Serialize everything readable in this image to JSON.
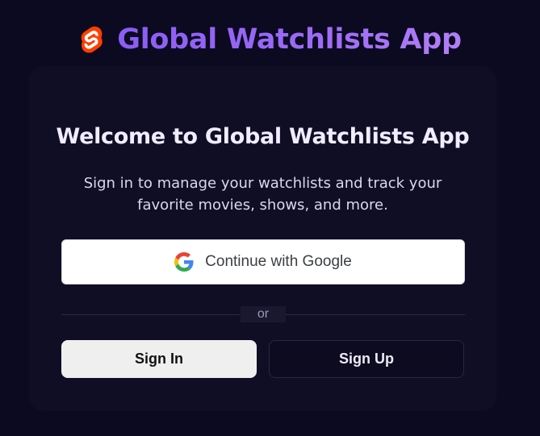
{
  "header": {
    "logo_icon": "svelte-logo-icon",
    "title": "Global Watchlists App"
  },
  "card": {
    "heading": "Welcome to Global Watchlists App",
    "subtitle": "Sign in to manage your watchlists and track your favorite movies, shows, and more.",
    "google_button_label": "Continue with Google",
    "google_icon": "google-icon",
    "divider_label": "or",
    "sign_in_label": "Sign In",
    "sign_up_label": "Sign Up"
  },
  "colors": {
    "background": "#0b0a20",
    "card_background": "#100e25",
    "title_gradient_start": "#8b5cf6",
    "title_gradient_end": "#b17ff5",
    "logo_orange": "#ff3e00"
  }
}
